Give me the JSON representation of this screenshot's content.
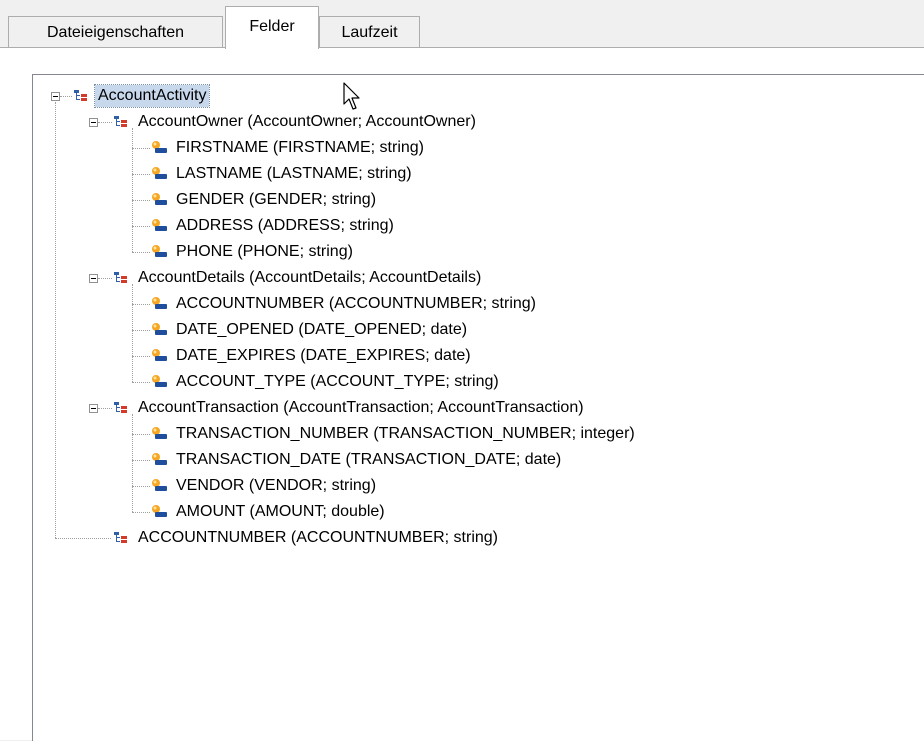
{
  "tabs": [
    {
      "label": "Dateieigenschaften",
      "active": false
    },
    {
      "label": "Felder",
      "active": true
    },
    {
      "label": "Laufzeit",
      "active": false
    }
  ],
  "tree": {
    "root": {
      "label": "AccountActivity",
      "selected": true,
      "expanded": true,
      "icon": "structure-icon"
    },
    "groups": [
      {
        "label": "AccountOwner (AccountOwner; AccountOwner)",
        "icon": "structure-icon",
        "expanded": true,
        "fields": [
          "FIRSTNAME (FIRSTNAME; string)",
          "LASTNAME (LASTNAME; string)",
          "GENDER (GENDER; string)",
          "ADDRESS (ADDRESS; string)",
          "PHONE (PHONE; string)"
        ]
      },
      {
        "label": "AccountDetails (AccountDetails; AccountDetails)",
        "icon": "structure-icon",
        "expanded": true,
        "fields": [
          "ACCOUNTNUMBER (ACCOUNTNUMBER; string)",
          "DATE_OPENED (DATE_OPENED; date)",
          "DATE_EXPIRES (DATE_EXPIRES; date)",
          "ACCOUNT_TYPE (ACCOUNT_TYPE; string)"
        ]
      },
      {
        "label": "AccountTransaction (AccountTransaction; AccountTransaction)",
        "icon": "structure-icon",
        "expanded": true,
        "fields": [
          "TRANSACTION_NUMBER (TRANSACTION_NUMBER; integer)",
          "TRANSACTION_DATE (TRANSACTION_DATE; date)",
          "VENDOR (VENDOR; string)",
          "AMOUNT (AMOUNT; double)"
        ]
      }
    ],
    "trailing": {
      "label": "ACCOUNTNUMBER (ACCOUNTNUMBER; string)",
      "icon": "structure-icon"
    }
  },
  "colors": {
    "selection": "#c7d8ed",
    "tree_border": "#828790",
    "tab_border": "#adadad",
    "struct_icon_blue": "#2e5fa8",
    "struct_icon_red": "#d23a2a",
    "field_icon_orange": "#f5a623",
    "field_icon_blue": "#1f4f9c"
  }
}
